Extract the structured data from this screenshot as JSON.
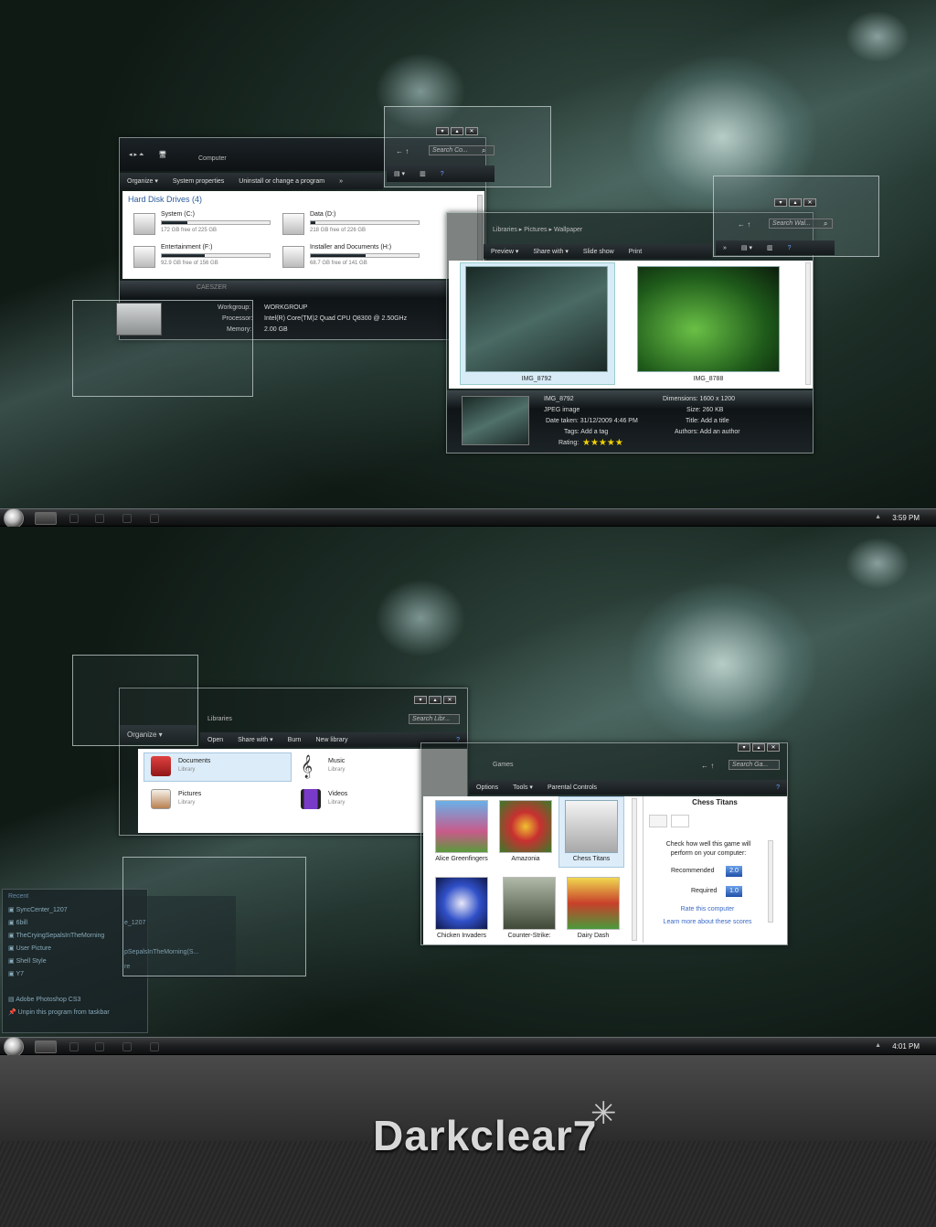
{
  "screen1": {
    "computer": {
      "breadcrumb": "Computer",
      "toolbar": [
        "Organize ▾",
        "System properties",
        "Uninstall or change a program",
        "»"
      ],
      "group_title": "Hard Disk Drives (4)",
      "drives": [
        {
          "name": "System (C:)",
          "free": "172 GB free of 225 GB",
          "used_fraction": 0.24
        },
        {
          "name": "Data (D:)",
          "free": "218 GB free of 226 GB",
          "used_fraction": 0.04
        },
        {
          "name": "Entertainment (F:)",
          "free": "92.9 GB free of 156 GB",
          "used_fraction": 0.4
        },
        {
          "name": "Installer and Documents (H:)",
          "free": "68.7 GB free of 141 GB",
          "used_fraction": 0.51
        }
      ],
      "machine": "CAESZER",
      "details": [
        {
          "label": "Workgroup:",
          "value": "WORKGROUP"
        },
        {
          "label": "Processor:",
          "value": "Intel(R) Core(TM)2 Quad CPU    Q8300  @ 2.50GHz"
        },
        {
          "label": "Memory:",
          "value": "2.00 GB"
        }
      ]
    },
    "mini_search1": "Search Co...",
    "pictures": {
      "breadcrumb": [
        "Libraries",
        "Pictures",
        "Wallpaper"
      ],
      "toolbar": [
        "Preview ▾",
        "Share with ▾",
        "Slide show",
        "Print"
      ],
      "images": [
        "IMG_8792",
        "IMG_8788"
      ],
      "detail": {
        "name": "IMG_8792",
        "type": "JPEG image",
        "date_taken": "Date taken: 31/12/2009 4:46 PM",
        "tags": "Tags: Add a tag",
        "rating_label": "Rating:",
        "rating": "★★★★★",
        "dimensions": "Dimensions: 1600 x 1200",
        "size": "Size: 260 KB",
        "title": "Title: Add a title",
        "authors": "Authors: Add an author"
      }
    },
    "mini_search2": "Search Wal...",
    "clock": "3:59 PM"
  },
  "screen2": {
    "libraries": {
      "breadcrumb": "Libraries",
      "search": "Search Libr...",
      "organize": "Organize ▾",
      "toolbar": [
        "Open",
        "Share with ▾",
        "Burn",
        "New library"
      ],
      "items": [
        {
          "title": "Documents",
          "sub": "Library"
        },
        {
          "title": "Music",
          "sub": "Library"
        },
        {
          "title": "Pictures",
          "sub": "Library"
        },
        {
          "title": "Videos",
          "sub": "Library"
        }
      ]
    },
    "games": {
      "breadcrumb": "Games",
      "search": "Search Ga...",
      "toolbar": [
        "Options",
        "Tools ▾",
        "Parental Controls"
      ],
      "games": [
        "Alice Greenfingers",
        "Amazonia",
        "Chess Titans",
        "Chicken Invaders",
        "Counter-Strike:",
        "Dairy Dash"
      ],
      "panel_title": "Chess Titans",
      "panel_text": "Check how well this game will perform on your computer:",
      "recommended_label": "Recommended",
      "recommended_value": "2.0",
      "required_label": "Required",
      "required_value": "1.0",
      "rate_link": "Rate this computer",
      "learn_link": "Learn more about these scores"
    },
    "jumplist": {
      "header": "Recent",
      "items": [
        "SyncCenter_1207",
        "6bill",
        "TheCryingSepalsInTheMorning",
        "User Picture",
        "Shell Style",
        "Y7"
      ],
      "app": "Adobe Photoshop CS3",
      "unpin": "Unpin this program from taskbar"
    },
    "jumplist_ghost": [
      "e_1207",
      "pSepalsInTheMorning(S...",
      "re"
    ],
    "clock": "4:01 PM"
  },
  "brand": {
    "logo": "Darkclear7"
  },
  "colors": {
    "accent": "#4a7fc0",
    "glass_border": "#cfd8d8",
    "bar_dark": "#151a1c"
  }
}
